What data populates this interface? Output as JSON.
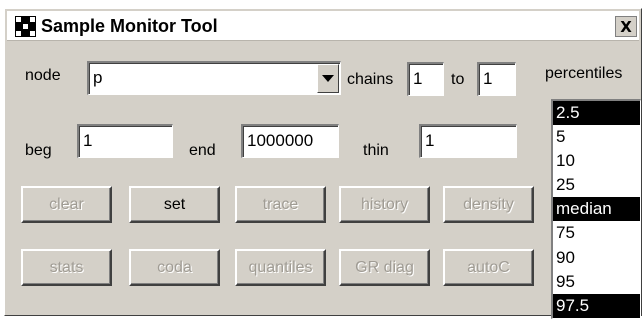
{
  "window": {
    "title": "Sample Monitor Tool",
    "close_label": "X"
  },
  "node": {
    "label": "node",
    "value": "p"
  },
  "chains": {
    "label": "chains",
    "from": "1",
    "to_label": "to",
    "to": "1"
  },
  "beg": {
    "label": "beg",
    "value": "1"
  },
  "end": {
    "label": "end",
    "value": "1000000"
  },
  "thin": {
    "label": "thin",
    "value": "1"
  },
  "buttons": {
    "clear": "clear",
    "set": "set",
    "trace": "trace",
    "history": "history",
    "density": "density",
    "stats": "stats",
    "coda": "coda",
    "quantiles": "quantiles",
    "gr_diag": "GR diag",
    "autoc": "autoC"
  },
  "percentiles": {
    "label": "percentiles",
    "items": [
      {
        "label": "2.5",
        "selected": true
      },
      {
        "label": "5",
        "selected": false
      },
      {
        "label": "10",
        "selected": false
      },
      {
        "label": "25",
        "selected": false
      },
      {
        "label": "median",
        "selected": true
      },
      {
        "label": "75",
        "selected": false
      },
      {
        "label": "90",
        "selected": false
      },
      {
        "label": "95",
        "selected": false
      },
      {
        "label": "97.5",
        "selected": true
      }
    ]
  },
  "colors": {
    "window_bg": "#d4d0c8",
    "selection_bg": "#000000",
    "disabled_text": "#a09c94"
  }
}
